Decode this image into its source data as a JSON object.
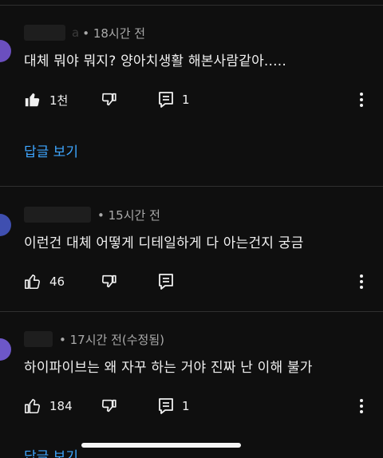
{
  "comments": [
    {
      "time": "• 18시간 전",
      "name_hint": "a",
      "text": "대체 뭐야 뭐지? 양아치생활 해본사람같아.....",
      "likes": "1천",
      "replies": "1",
      "liked": true,
      "view_replies": "답글 보기"
    },
    {
      "time": "• 15시간 전",
      "text": "이런건 대체 어떻게 디테일하게 다 아는건지 궁금",
      "likes": "46",
      "replies": "",
      "liked": false
    },
    {
      "time": "• 17시간 전(수정됨)",
      "text": "하이파이브는 왜 자꾸 하는 거야 진짜 난 이해 불가",
      "likes": "184",
      "replies": "1",
      "liked": false,
      "view_replies": "답글 보기"
    }
  ],
  "icons": {
    "like": "thumbs-up-icon",
    "dislike": "thumbs-down-icon",
    "reply": "comment-icon",
    "more": "more-vert-icon"
  },
  "colors": {
    "background": "#0f0f0f",
    "text": "#f1f1f1",
    "meta": "#aaaaaa",
    "link": "#3ea6ff"
  }
}
